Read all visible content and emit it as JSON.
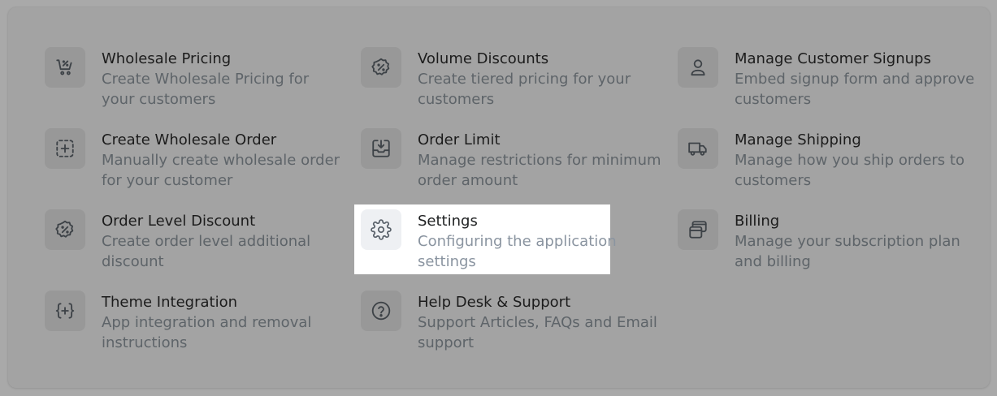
{
  "items": [
    {
      "title": "Wholesale Pricing",
      "desc": "Create Wholesale Pricing for your customers",
      "icon": "cart-discount-icon"
    },
    {
      "title": "Volume Discounts",
      "desc": "Create tiered pricing for your customers",
      "icon": "discount-badge-icon"
    },
    {
      "title": "Manage Customer Signups",
      "desc": "Embed signup form and approve customers",
      "icon": "person-icon"
    },
    {
      "title": "Create Wholesale Order",
      "desc": "Manually create wholesale order for your customer",
      "icon": "dashed-plus-icon"
    },
    {
      "title": "Order Limit",
      "desc": "Manage restrictions for minimum order amount",
      "icon": "inbox-download-icon"
    },
    {
      "title": "Manage Shipping",
      "desc": "Manage how you ship orders to customers",
      "icon": "truck-icon"
    },
    {
      "title": "Order Level Discount",
      "desc": "Create order level additional discount",
      "icon": "discount-badge-icon"
    },
    {
      "title": "Settings",
      "desc": "Configuring the application settings",
      "icon": "gear-icon"
    },
    {
      "title": "Billing",
      "desc": "Manage your subscription plan and billing",
      "icon": "credit-card-icon"
    },
    {
      "title": "Theme Integration",
      "desc": "App integration and removal instructions",
      "icon": "braces-plus-icon"
    },
    {
      "title": "Help Desk & Support",
      "desc": "Support Articles, FAQs and Email support",
      "icon": "question-circle-icon"
    }
  ],
  "colors": {
    "overlay_background": "#a9a9a9",
    "highlight_background": "#ffffff",
    "title_text": "#1c1c1c",
    "description_text": "#5e6469"
  }
}
